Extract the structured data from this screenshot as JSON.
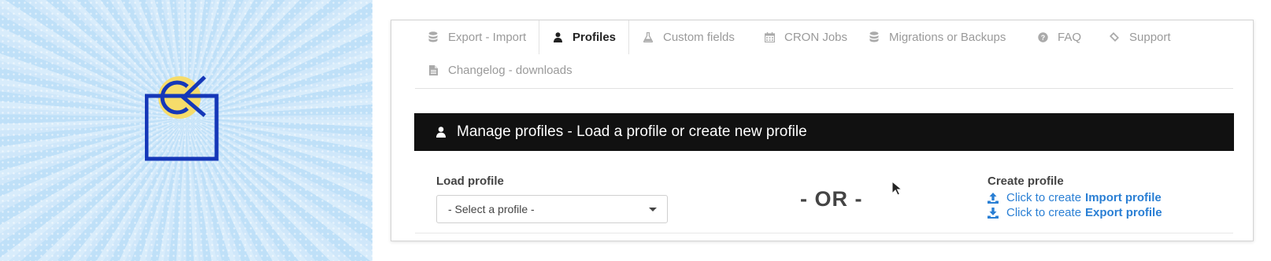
{
  "tabs": [
    {
      "label": "Export - Import",
      "icon": "database-icon",
      "active": false
    },
    {
      "label": "Profiles",
      "icon": "user-icon",
      "active": true
    },
    {
      "label": "Custom fields",
      "icon": "flask-icon",
      "active": false
    },
    {
      "label": "CRON Jobs",
      "icon": "calendar-icon",
      "active": false
    },
    {
      "label": "Migrations or Backups",
      "icon": "database-icon",
      "active": false
    },
    {
      "label": "FAQ",
      "icon": "question-circle-icon",
      "active": false
    },
    {
      "label": "Support",
      "icon": "ticket-icon",
      "active": false
    },
    {
      "label": "Changelog - downloads",
      "icon": "file-icon",
      "active": false
    }
  ],
  "header": {
    "title": "Manage profiles - Load a profile or create new profile",
    "icon": "user-icon"
  },
  "load": {
    "label": "Load profile",
    "selected": "- Select a profile -"
  },
  "or_text": "- OR -",
  "create": {
    "label": "Create profile",
    "import_prefix": "Click to create",
    "import_bold": "Import profile",
    "export_prefix": "Click to create",
    "export_bold": "Export profile"
  },
  "colors": {
    "accent": "#2a7fd4",
    "header_bg": "#111111",
    "logo_blue": "#1537b8",
    "logo_yellow": "#f6dc6a"
  }
}
